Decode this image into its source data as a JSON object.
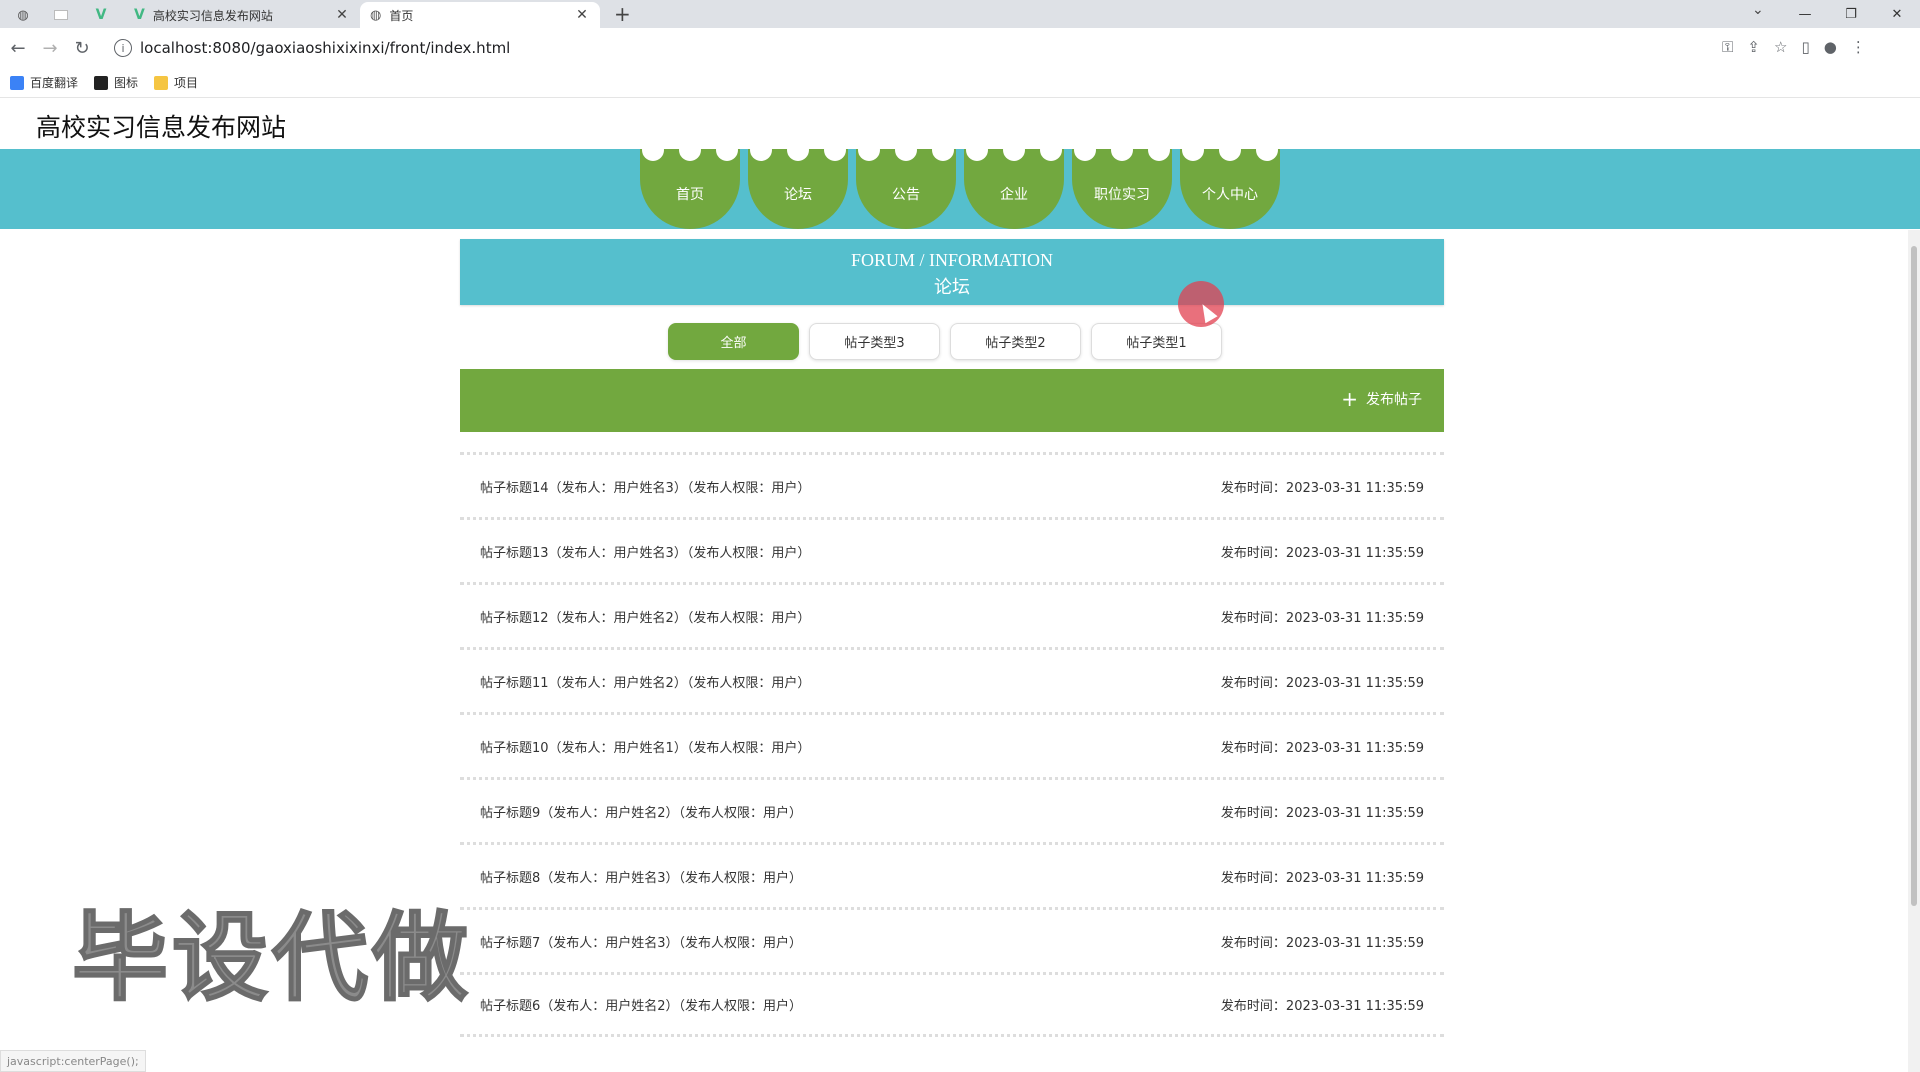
{
  "browser": {
    "tabs": [
      {
        "title": "高校实习信息发布网站",
        "active": false
      },
      {
        "title": "首页",
        "active": true
      }
    ],
    "url": "localhost:8080/gaoxiaoshixixinxi/front/index.html",
    "bookmarks": [
      {
        "label": "百度翻译",
        "icon": "baidu-translate-icon"
      },
      {
        "label": "图标",
        "icon": "image-icon"
      },
      {
        "label": "项目",
        "icon": "folder-icon"
      }
    ],
    "status_text": "javascript:centerPage();"
  },
  "site": {
    "title": "高校实习信息发布网站",
    "nav": [
      {
        "label": "首页"
      },
      {
        "label": "论坛"
      },
      {
        "label": "公告"
      },
      {
        "label": "企业"
      },
      {
        "label": "职位实习"
      },
      {
        "label": "个人中心"
      }
    ]
  },
  "banner": {
    "en": "FORUM / INFORMATION",
    "cn": "论坛"
  },
  "filters": [
    {
      "label": "全部",
      "active": true
    },
    {
      "label": "帖子类型3",
      "active": false
    },
    {
      "label": "帖子类型2",
      "active": false
    },
    {
      "label": "帖子类型1",
      "active": false
    }
  ],
  "actions": {
    "publish_label": "发布帖子"
  },
  "posts": [
    {
      "title": "帖子标题14（发布人：用户姓名3）（发布人权限：用户）",
      "time": "发布时间：2023-03-31 11:35:59"
    },
    {
      "title": "帖子标题13（发布人：用户姓名3）（发布人权限：用户）",
      "time": "发布时间：2023-03-31 11:35:59"
    },
    {
      "title": "帖子标题12（发布人：用户姓名2）（发布人权限：用户）",
      "time": "发布时间：2023-03-31 11:35:59"
    },
    {
      "title": "帖子标题11（发布人：用户姓名2）（发布人权限：用户）",
      "time": "发布时间：2023-03-31 11:35:59"
    },
    {
      "title": "帖子标题10（发布人：用户姓名1）（发布人权限：用户）",
      "time": "发布时间：2023-03-31 11:35:59"
    },
    {
      "title": "帖子标题9（发布人：用户姓名2）（发布人权限：用户）",
      "time": "发布时间：2023-03-31 11:35:59"
    },
    {
      "title": "帖子标题8（发布人：用户姓名3）（发布人权限：用户）",
      "time": "发布时间：2023-03-31 11:35:59"
    },
    {
      "title": "帖子标题7（发布人：用户姓名3）（发布人权限：用户）",
      "time": "发布时间：2023-03-31 11:35:59"
    },
    {
      "title": "帖子标题6（发布人：用户姓名2）（发布人权限：用户）",
      "time": "发布时间：2023-03-31 11:35:59"
    }
  ],
  "watermark": "毕设代做",
  "colors": {
    "accent_teal": "#55bfcd",
    "accent_green": "#72a83f"
  }
}
